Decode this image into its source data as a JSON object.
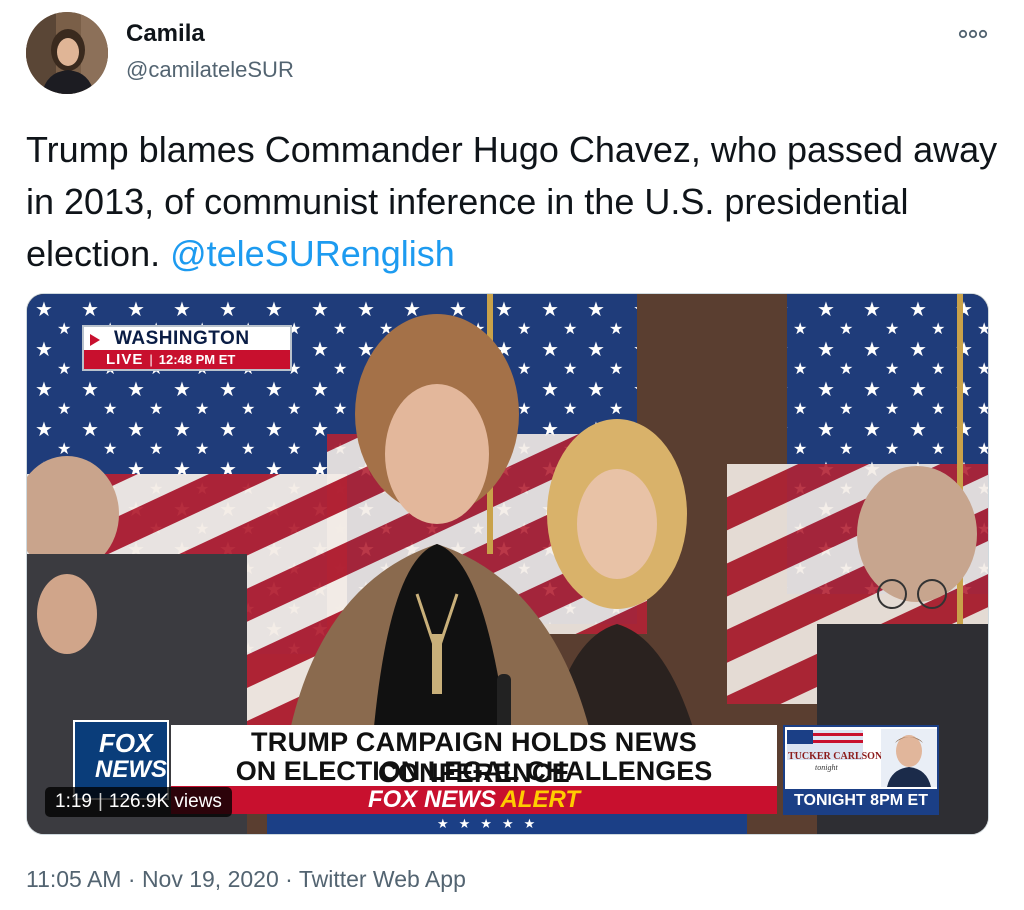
{
  "author": {
    "name": "Camila",
    "handle": "@camilateleSUR"
  },
  "tweet": {
    "text": "Trump blames Commander Hugo Chavez, who passed away in 2013, of communist inference in the U.S. presidential election.",
    "mention": "@teleSURenglish"
  },
  "video": {
    "location": "WASHINGTON",
    "live_label": "LIVE",
    "live_sep": "|",
    "live_time": "12:48 PM ET",
    "network_top": "FOX",
    "network_bottom": "NEWS",
    "headline_line1": "TRUMP CAMPAIGN HOLDS NEWS CONFERENCE",
    "headline_line2": "ON ELECTION LEGAL CHALLENGES",
    "alert_prefix": "FOX NEWS",
    "alert_word": "ALERT",
    "promo_show": "TUCKER CARLSON",
    "promo_sub": "tonight",
    "promo_time": "TONIGHT 8PM ET",
    "duration": "1:19",
    "views": "126.9K views"
  },
  "footer": {
    "time": "11:05 AM",
    "date": "Nov 19, 2020",
    "source": "Twitter Web App",
    "dot": "·"
  },
  "colors": {
    "link": "#1d9bf0",
    "fox_red": "#c8102e",
    "fox_blue": "#1b3f86"
  }
}
